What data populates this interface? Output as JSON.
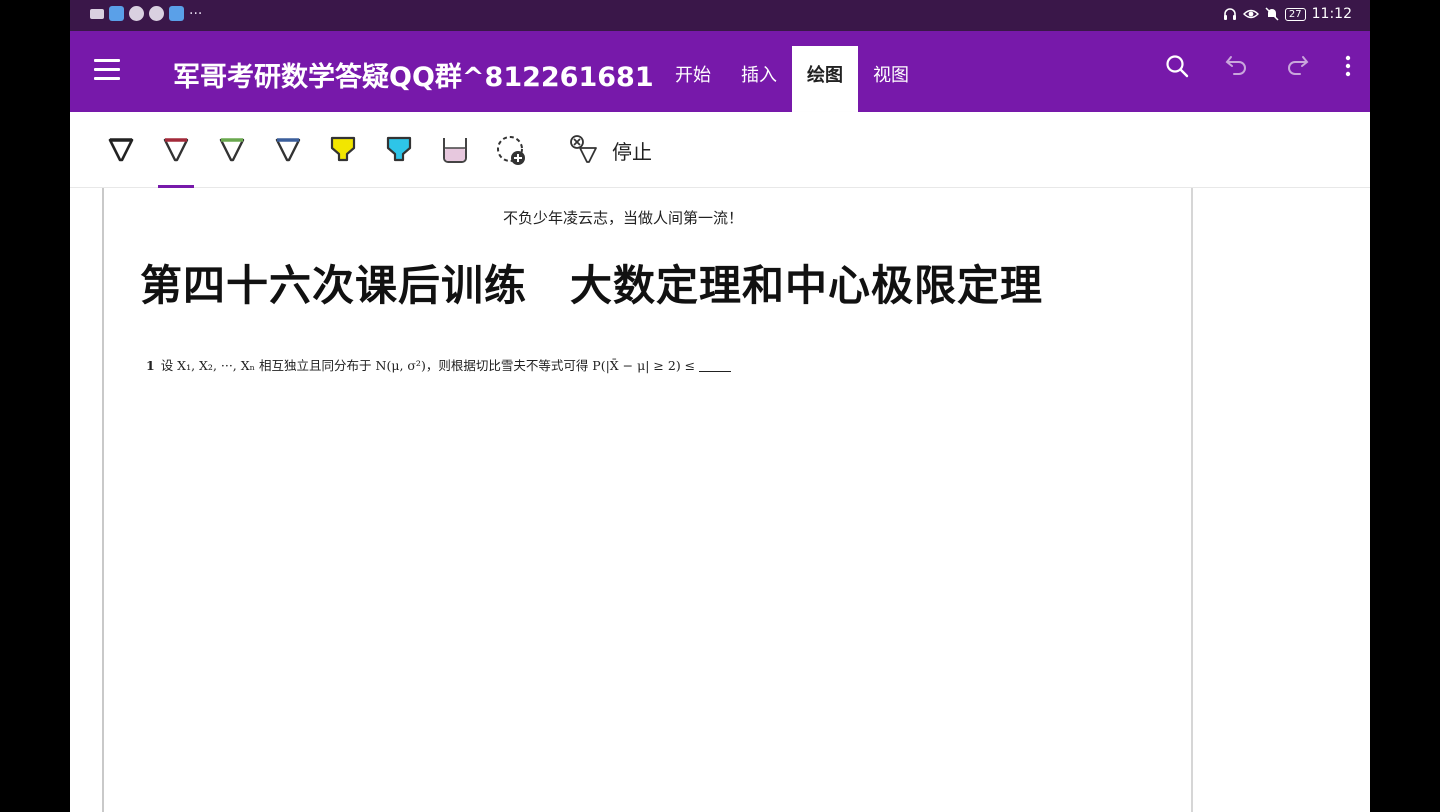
{
  "statusbar": {
    "left_icons": [
      "camera-icon",
      "map-pin-icon",
      "wechat-icon",
      "app-icon",
      "search-app-icon"
    ],
    "overflow": "···",
    "battery": "27",
    "time": "11:12"
  },
  "appbar": {
    "title": "军哥考研数学答疑QQ群^812261681",
    "tabs": [
      {
        "label": "开始",
        "active": false
      },
      {
        "label": "插入",
        "active": false
      },
      {
        "label": "绘图",
        "active": true
      },
      {
        "label": "视图",
        "active": false
      }
    ],
    "actions": [
      "search-icon",
      "undo-icon",
      "redo-icon",
      "more-icon"
    ]
  },
  "toolbar": {
    "pens": [
      {
        "name": "pen-black",
        "color": "#222222",
        "selected": false
      },
      {
        "name": "pen-red",
        "color": "#a32a3a",
        "selected": true
      },
      {
        "name": "pen-green",
        "color": "#6aa84f",
        "selected": false
      },
      {
        "name": "pen-blue",
        "color": "#3c5f9c",
        "selected": false
      },
      {
        "name": "highlighter-yellow",
        "color": "#f2e600",
        "selected": false
      },
      {
        "name": "highlighter-cyan",
        "color": "#2ec5e8",
        "selected": false
      },
      {
        "name": "highlighter-pink",
        "color": "#e7c8de",
        "selected": false
      }
    ],
    "stop_label": "停止"
  },
  "page": {
    "motto": "不负少年凌云志，当做人间第一流！",
    "heading": "第四十六次课后训练　大数定理和中心极限定理",
    "question": {
      "number": "1",
      "text": "设 X₁, X₂, ···, Xₙ 相互独立且同分布于 N(μ, σ²)，则根据切比雪夫不等式可得 P(|X̄ − μ| ≥ 2) ≤"
    }
  },
  "colors": {
    "brand": "#7719aa",
    "statusbar": "#3a1749"
  }
}
